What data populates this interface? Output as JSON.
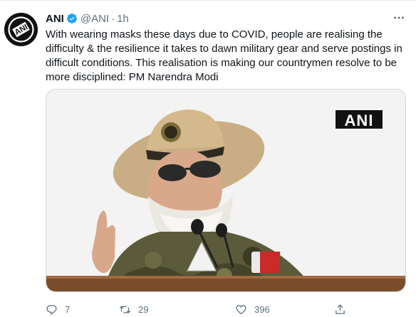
{
  "tweet": {
    "author": {
      "name": "ANI",
      "handle": "@ANI",
      "time": "1h",
      "verified": true,
      "avatar_text": "ANI"
    },
    "text": "With wearing masks these days due to COVID, people are realising the difficulty & the resilience it takes to dawn military gear and serve postings in difficult conditions. This realisation is making our countrymen resolve to be more disciplined: PM Narendra Modi",
    "media": {
      "watermark": "ANI"
    },
    "actions": {
      "reply_count": "7",
      "retweet_count": "29",
      "like_count": "396"
    }
  },
  "colors": {
    "text": "#0f1419",
    "secondary": "#5b7083",
    "verified": "#1da1f2",
    "border": "#cfd9de"
  },
  "icons": [
    "more-icon",
    "verified-icon",
    "reply-icon",
    "retweet-icon",
    "like-icon",
    "share-icon"
  ]
}
